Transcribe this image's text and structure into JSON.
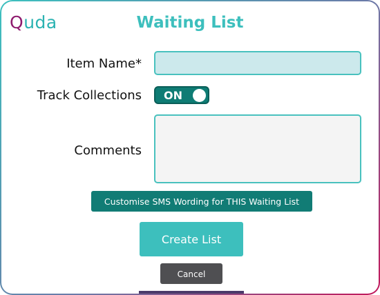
{
  "brand": {
    "logo_first": "Q",
    "logo_rest": "uda",
    "color_primary": "#8e1b6e",
    "color_accent": "#2bb3b2"
  },
  "dialog": {
    "title": "Waiting List"
  },
  "form": {
    "item_name_label": "Item Name*",
    "item_name_value": "",
    "track_collections_label": "Track Collections",
    "track_collections_state": "ON",
    "comments_label": "Comments",
    "comments_value": ""
  },
  "actions": {
    "sms_button_label": "Customise SMS Wording for THIS Waiting List",
    "create_button_label": "Create List",
    "cancel_button_label": "Cancel"
  },
  "colors": {
    "teal": "#3dbfbd",
    "dark_teal": "#117c75",
    "input_fill": "#cce9ec",
    "cancel_gray": "#4f4f52"
  }
}
